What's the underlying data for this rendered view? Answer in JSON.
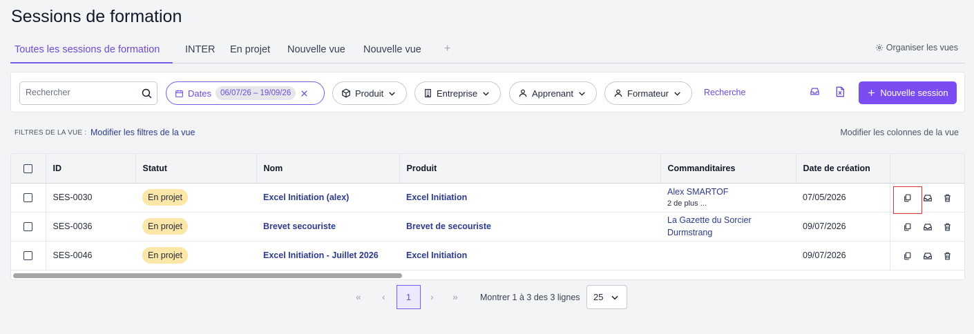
{
  "page": {
    "title": "Sessions de formation"
  },
  "tabs": [
    {
      "label": "Toutes les sessions de formation",
      "active": true
    },
    {
      "label": "INTER"
    },
    {
      "label": "En projet"
    },
    {
      "label": "Nouvelle vue"
    },
    {
      "label": "Nouvelle vue"
    }
  ],
  "tabs_add": "+",
  "organize_label": "Organiser les vues",
  "filters": {
    "search_placeholder": "Rechercher",
    "dates_label": "Dates",
    "dates_range": "06/07/26 – 19/09/26",
    "produit": "Produit",
    "entreprise": "Entreprise",
    "apprenant": "Apprenant",
    "formateur": "Formateur",
    "recherche": "Recherche",
    "new_session": "Nouvelle session"
  },
  "view_filters": {
    "label": "FILTRES DE LA VUE :",
    "link": "Modifier les filtres de la vue",
    "modify_columns": "Modifier les colonnes de la vue"
  },
  "table": {
    "columns": [
      "ID",
      "Statut",
      "Nom",
      "Produit",
      "Commanditaires",
      "Date de création"
    ],
    "rows": [
      {
        "id": "SES-0030",
        "statut": "En projet",
        "nom": "Excel Initiation (alex)",
        "produit": "Excel Initiation",
        "commanditaire1": "Alex SMARTOF",
        "commanditaire2": "2 de plus ...",
        "date": "07/05/2026"
      },
      {
        "id": "SES-0036",
        "statut": "En projet",
        "nom": "Brevet secouriste",
        "produit": "Brevet de secouriste",
        "commanditaire1": "La Gazette du Sorcier",
        "commanditaire2": "Durmstrang",
        "date": "09/07/2026"
      },
      {
        "id": "SES-0046",
        "statut": "En projet",
        "nom": "Excel Initiation - Juillet 2026",
        "produit": "Excel Initiation",
        "commanditaire1": "",
        "commanditaire2": "",
        "date": "09/07/2026"
      }
    ]
  },
  "pagination": {
    "first": "«",
    "prev": "‹",
    "current": "1",
    "next": "›",
    "last": "»",
    "info": "Montrer 1 à 3 des 3 lignes",
    "page_size": "25"
  },
  "colors": {
    "accent": "#7b4cf2",
    "link": "#2d3a8c",
    "badge": "#fde7a8",
    "highlight": "#e03131"
  },
  "icons": [
    "search-icon",
    "calendar-icon",
    "close-icon",
    "cube-icon",
    "building-icon",
    "user-icon",
    "chevron-down-icon",
    "gear-icon",
    "inbox-icon",
    "excel-file-icon",
    "plus-icon",
    "copy-icon",
    "trash-icon"
  ]
}
